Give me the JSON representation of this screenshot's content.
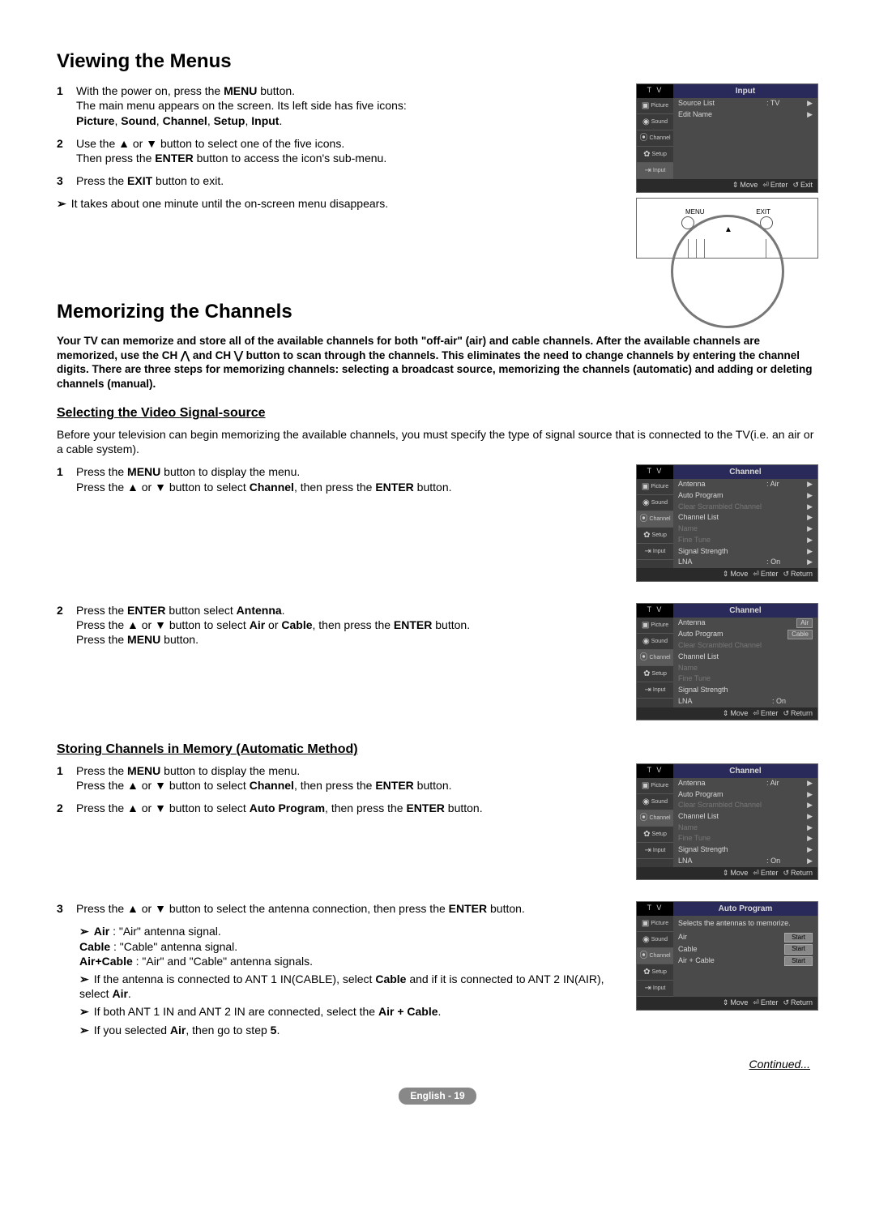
{
  "sec1": {
    "title": "Viewing the Menus",
    "steps": [
      {
        "n": "1",
        "lines": [
          "With the power on, press the <b>MENU</b> button.",
          "The main menu appears on the screen. Its left side has five icons:",
          "<b>Picture</b>, <b>Sound</b>, <b>Channel</b>, <b>Setup</b>, <b>Input</b>."
        ]
      },
      {
        "n": "2",
        "lines": [
          "Use the ▲ or ▼ button to select one of the five icons.",
          "Then press the <b>ENTER</b> button to access the icon's sub-menu."
        ]
      },
      {
        "n": "3",
        "lines": [
          "Press the <b>EXIT</b> button to exit."
        ]
      }
    ],
    "note": "It takes about one minute until the on-screen menu disappears.",
    "menu": {
      "tv": "T V",
      "title": "Input",
      "side": [
        "Picture",
        "Sound",
        "Channel",
        "Setup",
        "Input"
      ],
      "items": [
        {
          "lbl": "Source List",
          "val": ": TV",
          "caret": "▶"
        },
        {
          "lbl": "Edit Name",
          "val": "",
          "caret": "▶"
        }
      ],
      "foot": {
        "move": "Move",
        "enter": "Enter",
        "ret": "Exit"
      }
    },
    "remote": {
      "menu": "MENU",
      "exit": "EXIT"
    }
  },
  "sec2": {
    "title": "Memorizing the Channels",
    "intro": "Your TV can memorize and store all of the available channels for both \"off-air\" (air) and cable channels. After the available channels are memorized, use the CH ⋀ and CH ⋁ button to scan through the channels. This eliminates the need to change channels by entering the channel digits. There are three steps for memorizing channels: selecting a broadcast source, memorizing the channels (automatic) and adding or deleting channels (manual).",
    "sub1": {
      "title": "Selecting the Video Signal-source",
      "intro": "Before your television can begin memorizing the available channels, you must specify the type of signal source that is connected to the TV(i.e. an air or a cable system).",
      "steps": [
        {
          "n": "1",
          "lines": [
            "Press the <b>MENU</b> button to display the menu.",
            "Press the ▲ or ▼ button to select <b>Channel</b>, then press the <b>ENTER</b> button."
          ]
        },
        {
          "n": "2",
          "lines": [
            "Press the <b>ENTER</b> button select <b>Antenna</b>.",
            "Press the ▲ or ▼ button to select <b>Air</b> or <b>Cable</b>, then press the <b>ENTER</b> button.",
            "Press the <b>MENU</b> button."
          ]
        }
      ],
      "menuA": {
        "tv": "T V",
        "title": "Channel",
        "side": [
          "Picture",
          "Sound",
          "Channel",
          "Setup",
          "Input"
        ],
        "items": [
          {
            "lbl": "Antenna",
            "val": ": Air",
            "caret": "▶"
          },
          {
            "lbl": "Auto Program",
            "val": "",
            "caret": "▶"
          },
          {
            "lbl": "Clear Scrambled Channel",
            "val": "",
            "caret": "▶",
            "dim": true
          },
          {
            "lbl": "Channel List",
            "val": "",
            "caret": "▶"
          },
          {
            "lbl": "Name",
            "val": "",
            "caret": "▶",
            "dim": true
          },
          {
            "lbl": "Fine Tune",
            "val": "",
            "caret": "▶",
            "dim": true
          },
          {
            "lbl": "Signal Strength",
            "val": "",
            "caret": "▶"
          },
          {
            "lbl": "LNA",
            "val": ": On",
            "caret": "▶"
          }
        ],
        "foot": {
          "move": "Move",
          "enter": "Enter",
          "ret": "Return"
        }
      },
      "menuB": {
        "tv": "T V",
        "title": "Channel",
        "side": [
          "Picture",
          "Sound",
          "Channel",
          "Setup",
          "Input"
        ],
        "items": [
          {
            "lbl": "Antenna",
            "val": "",
            "sel": "Air"
          },
          {
            "lbl": "Auto Program",
            "val": "",
            "sel": "Cable"
          },
          {
            "lbl": "Clear Scrambled Channel",
            "val": "",
            "dim": true
          },
          {
            "lbl": "Channel List",
            "val": ""
          },
          {
            "lbl": "Name",
            "val": "",
            "dim": true
          },
          {
            "lbl": "Fine Tune",
            "val": "",
            "dim": true
          },
          {
            "lbl": "Signal Strength",
            "val": ""
          },
          {
            "lbl": "LNA",
            "val": ": On"
          }
        ],
        "foot": {
          "move": "Move",
          "enter": "Enter",
          "ret": "Return"
        }
      }
    },
    "sub2": {
      "title": "Storing Channels in Memory (Automatic Method)",
      "steps": [
        {
          "n": "1",
          "lines": [
            "Press the <b>MENU</b> button to display the menu.",
            "Press the ▲ or ▼ button to select <b>Channel</b>, then press the <b>ENTER</b> button."
          ]
        },
        {
          "n": "2",
          "lines": [
            "Press the ▲ or ▼ button to select <b>Auto Program</b>, then press the <b>ENTER</b> button."
          ]
        },
        {
          "n": "3",
          "lines": [
            "Press the ▲ or ▼ button to select the antenna connection, then press the <b>ENTER</b> button."
          ]
        }
      ],
      "notes": [
        "<b>Air</b> : \"Air\" antenna signal.<br><b>Cable</b> : \"Cable\" antenna signal.<br><b>Air+Cable</b> : \"Air\" and \"Cable\" antenna signals.",
        "If the antenna is connected to ANT 1 IN(CABLE), select <b>Cable</b> and if it is connected to ANT 2 IN(AIR), select <b>Air</b>.",
        "If both ANT 1 IN and ANT 2 IN are connected, select the <b>Air + Cable</b>.",
        "If you selected <b>Air</b>, then go to step <b>5</b>."
      ],
      "menuC": {
        "tv": "T V",
        "title": "Channel",
        "side": [
          "Picture",
          "Sound",
          "Channel",
          "Setup",
          "Input"
        ],
        "items": [
          {
            "lbl": "Antenna",
            "val": ": Air",
            "caret": "▶"
          },
          {
            "lbl": "Auto Program",
            "val": "",
            "caret": "▶"
          },
          {
            "lbl": "Clear Scrambled Channel",
            "val": "",
            "caret": "▶",
            "dim": true
          },
          {
            "lbl": "Channel List",
            "val": "",
            "caret": "▶"
          },
          {
            "lbl": "Name",
            "val": "",
            "caret": "▶",
            "dim": true
          },
          {
            "lbl": "Fine Tune",
            "val": "",
            "caret": "▶",
            "dim": true
          },
          {
            "lbl": "Signal Strength",
            "val": "",
            "caret": "▶"
          },
          {
            "lbl": "LNA",
            "val": ": On",
            "caret": "▶"
          }
        ],
        "foot": {
          "move": "Move",
          "enter": "Enter",
          "ret": "Return"
        }
      },
      "menuD": {
        "tv": "T V",
        "title": "Auto Program",
        "side": [
          "Picture",
          "Sound",
          "Channel",
          "Setup",
          "Input"
        ],
        "note": "Selects the antennas to memorize.",
        "items": [
          {
            "lbl": "Air",
            "btn": "Start"
          },
          {
            "lbl": "Cable",
            "btn": "Start"
          },
          {
            "lbl": "Air + Cable",
            "btn": "Start"
          }
        ],
        "foot": {
          "move": "Move",
          "enter": "Enter",
          "ret": "Return"
        }
      }
    }
  },
  "continued": "Continued...",
  "page": "English - 19"
}
